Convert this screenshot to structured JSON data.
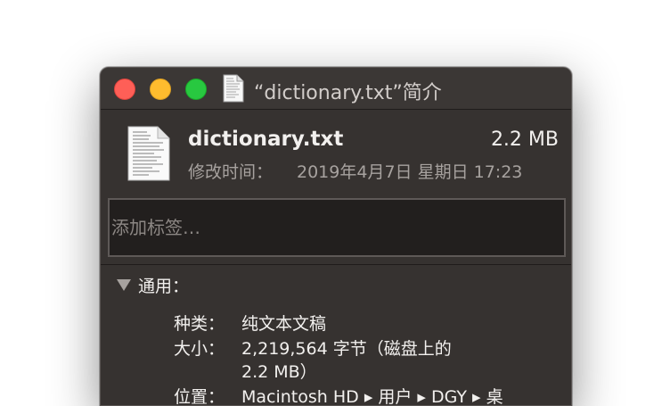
{
  "window": {
    "title": "“dictionary.txt”简介"
  },
  "file": {
    "name": "dictionary.txt",
    "size": "2.2 MB",
    "modified_label": "修改时间：",
    "modified_value": "2019年4月7日 星期日 17:23"
  },
  "tags": {
    "placeholder": "添加标签…"
  },
  "general": {
    "title": "通用：",
    "kind_label": "种类：",
    "kind_value": "纯文本文稿",
    "size_label": "大小：",
    "size_value_line1": "2,219,564 字节（磁盘上的",
    "size_value_line2": "2.2 MB）",
    "where_label": "位置：",
    "where_value": "Macintosh HD ▸ 用户 ▸ DGY ▸ 桌"
  },
  "colors": {
    "window_bg": "#363230",
    "close": "#fe5f57",
    "minimize": "#febc2e",
    "maximize": "#28c840"
  }
}
